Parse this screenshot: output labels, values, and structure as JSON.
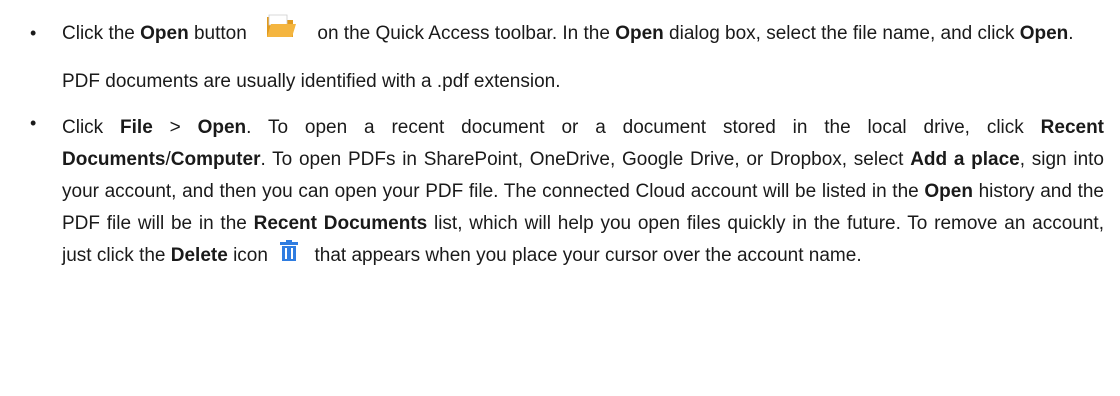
{
  "bullet_char": "•",
  "item1": {
    "t1": "Click the ",
    "b1": "Open",
    "t2": " button ",
    "open_icon": "folder-open-icon",
    "t3": " on the Quick Access toolbar. In the ",
    "b2": "Open",
    "t4": " dialog box, select the file name, and click ",
    "b3": "Open",
    "t5": ". PDF documents are usually identified with a .pdf extension."
  },
  "item2": {
    "t1": "Click ",
    "b1": "File",
    "t2": " > ",
    "b2": "Open",
    "t3": ". To open a recent document or a document stored in the local drive, click ",
    "b3": "Recent Documents",
    "t4": "/",
    "b4": "Computer",
    "t5": ". To open PDFs in SharePoint, OneDrive, Google Drive, or Dropbox, select ",
    "b5": "Add a place",
    "t6": ", sign into your account, and then you can open your PDF file. The connected Cloud account will be listed in the ",
    "b6": "Open",
    "t7": " history and the PDF file will be in the ",
    "b7": "Recent Documents",
    "t8": " list, which will help you open files quickly in the future. To remove an account, just click the ",
    "b8": "Delete",
    "t9": " icon ",
    "delete_icon": "trash-icon",
    "t10": " that appears when you place your cursor over the account name."
  },
  "colors": {
    "folder": "#f4b53f",
    "folder_dark": "#e09a1f",
    "trash": "#2f7de1"
  }
}
